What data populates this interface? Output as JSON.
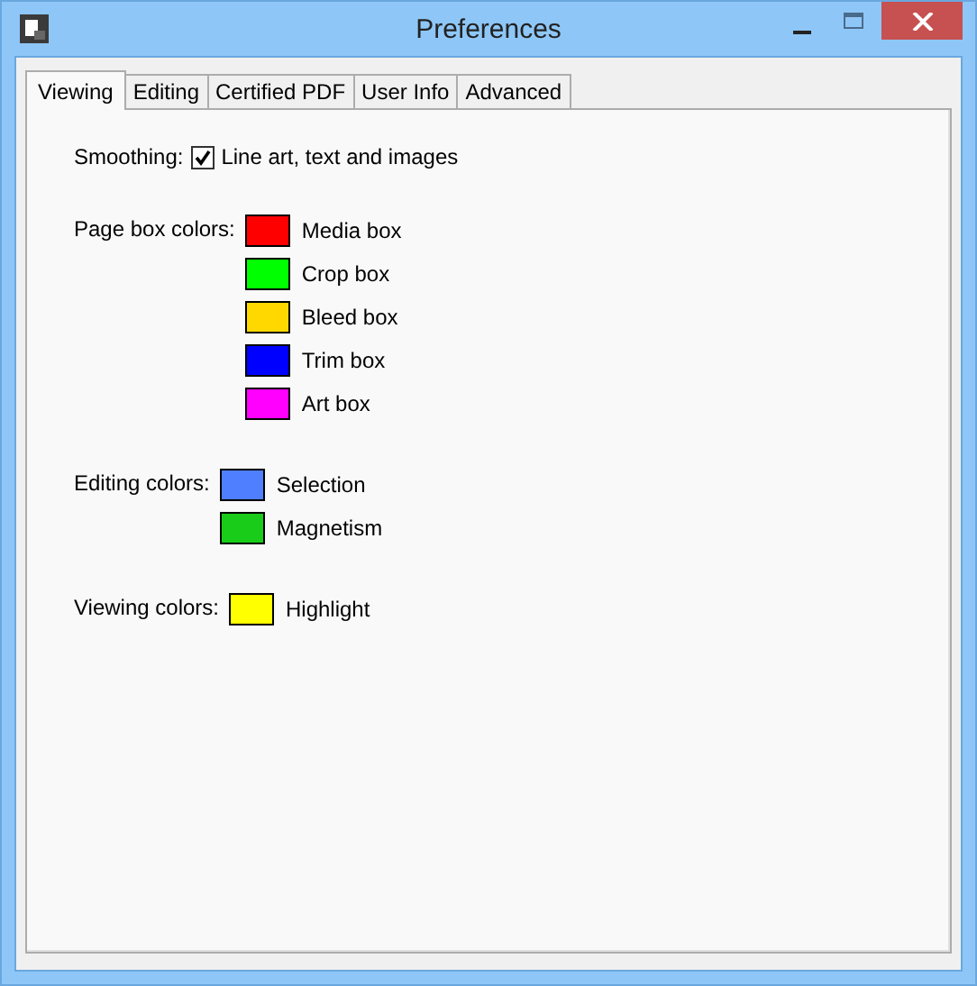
{
  "window": {
    "title": "Preferences"
  },
  "tabs": [
    {
      "label": "Viewing",
      "selected": true
    },
    {
      "label": "Editing",
      "selected": false
    },
    {
      "label": "Certified PDF",
      "selected": false
    },
    {
      "label": "User Info",
      "selected": false
    },
    {
      "label": "Advanced",
      "selected": false
    }
  ],
  "smoothing": {
    "label": "Smoothing:",
    "option": "Line art, text and images",
    "checked": true
  },
  "color_groups": [
    {
      "label": "Page box colors:",
      "items": [
        {
          "name": "Media box",
          "color": "#ff0000"
        },
        {
          "name": "Crop box",
          "color": "#00ff00"
        },
        {
          "name": "Bleed box",
          "color": "#ffd800"
        },
        {
          "name": "Trim box",
          "color": "#0000ff"
        },
        {
          "name": "Art box",
          "color": "#ff00ff"
        }
      ]
    },
    {
      "label": "Editing colors:",
      "items": [
        {
          "name": "Selection",
          "color": "#4f7fff"
        },
        {
          "name": "Magnetism",
          "color": "#19cc19"
        }
      ]
    },
    {
      "label": "Viewing colors:",
      "items": [
        {
          "name": "Highlight",
          "color": "#ffff00"
        }
      ]
    }
  ]
}
